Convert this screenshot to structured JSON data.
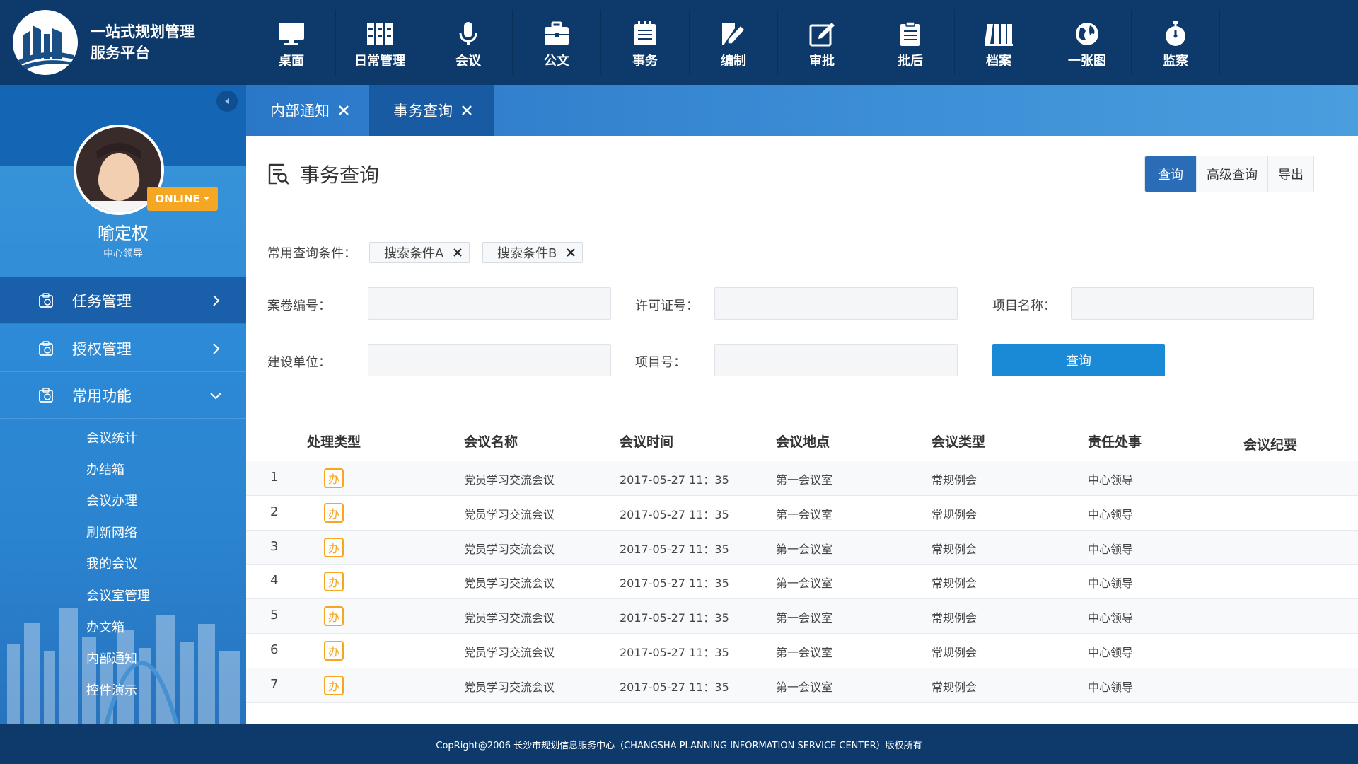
{
  "app": {
    "title_line1": "一站式规划管理",
    "title_line2": "服务平台"
  },
  "top_nav": [
    {
      "label": "桌面",
      "icon": "desktop-icon"
    },
    {
      "label": "日常管理",
      "icon": "grid-icon"
    },
    {
      "label": "会议",
      "icon": "microphone-icon"
    },
    {
      "label": "公文",
      "icon": "briefcase-icon"
    },
    {
      "label": "事务",
      "icon": "notepad-icon"
    },
    {
      "label": "编制",
      "icon": "pen-icon"
    },
    {
      "label": "审批",
      "icon": "edit-icon"
    },
    {
      "label": "批后",
      "icon": "clipboard-icon"
    },
    {
      "label": "档案",
      "icon": "archive-icon"
    },
    {
      "label": "一张图",
      "icon": "globe-icon"
    },
    {
      "label": "监察",
      "icon": "stopwatch-icon"
    }
  ],
  "user": {
    "status": "ONLINE",
    "name": "喻定权",
    "role": "中心领导"
  },
  "sidebar": {
    "menus": [
      {
        "label": "任务管理",
        "expanded": false
      },
      {
        "label": "授权管理",
        "expanded": false
      },
      {
        "label": "常用功能",
        "expanded": true
      }
    ],
    "sub_items": [
      "会议统计",
      "办结箱",
      "会议办理",
      "刷新网络",
      "我的会议",
      "会议室管理",
      "办文箱",
      "内部通知",
      "控件演示"
    ]
  },
  "tabs": [
    {
      "label": "内部通知",
      "active": false
    },
    {
      "label": "事务查询",
      "active": true
    }
  ],
  "page": {
    "title": "事务查询",
    "buttons": {
      "query": "查询",
      "advanced": "高级查询",
      "export": "导出"
    }
  },
  "filters": {
    "common_label": "常用查询条件：",
    "chips": [
      "搜索条件A",
      "搜索条件B"
    ],
    "case_no_label": "案卷编号：",
    "license_label": "许可证号：",
    "project_name_label": "项目名称：",
    "builder_label": "建设单位：",
    "project_no_label": "项目号：",
    "case_no_value": "",
    "license_value": "",
    "project_name_value": "",
    "builder_value": "",
    "project_no_value": "",
    "submit_label": "查询"
  },
  "table": {
    "columns": [
      "处理类型",
      "会议名称",
      "会议时间",
      "会议地点",
      "会议类型",
      "责任处事",
      "会议纪要"
    ],
    "action_badge": "办",
    "rows": [
      {
        "index": "1",
        "name": "党员学习交流会议",
        "time": "2017-05-27  11：35",
        "place": "第一会议室",
        "type": "常规例会",
        "owner": "中心领导",
        "minutes": ""
      },
      {
        "index": "2",
        "name": "党员学习交流会议",
        "time": "2017-05-27  11：35",
        "place": "第一会议室",
        "type": "常规例会",
        "owner": "中心领导",
        "minutes": ""
      },
      {
        "index": "3",
        "name": "党员学习交流会议",
        "time": "2017-05-27  11：35",
        "place": "第一会议室",
        "type": "常规例会",
        "owner": "中心领导",
        "minutes": ""
      },
      {
        "index": "4",
        "name": "党员学习交流会议",
        "time": "2017-05-27  11：35",
        "place": "第一会议室",
        "type": "常规例会",
        "owner": "中心领导",
        "minutes": ""
      },
      {
        "index": "5",
        "name": "党员学习交流会议",
        "time": "2017-05-27  11：35",
        "place": "第一会议室",
        "type": "常规例会",
        "owner": "中心领导",
        "minutes": ""
      },
      {
        "index": "6",
        "name": "党员学习交流会议",
        "time": "2017-05-27  11：35",
        "place": "第一会议室",
        "type": "常规例会",
        "owner": "中心领导",
        "minutes": ""
      },
      {
        "index": "7",
        "name": "党员学习交流会议",
        "time": "2017-05-27  11：35",
        "place": "第一会议室",
        "type": "常规例会",
        "owner": "中心领导",
        "minutes": ""
      }
    ]
  },
  "footer": {
    "text": "CopRight@2006 长沙市规划信息服务中心（CHANGSHA PLANNING INFORMATION SERVICE CENTER）版权所有"
  },
  "colors": {
    "header": "#0e3a6b",
    "sidebar": "#2d8ad6",
    "accent": "#1a8ad6",
    "badge": "#f5a623"
  }
}
